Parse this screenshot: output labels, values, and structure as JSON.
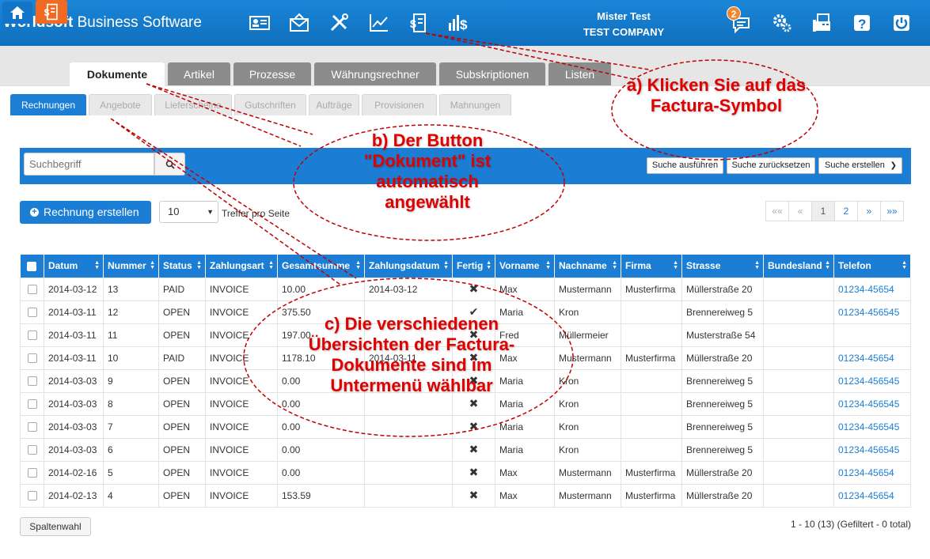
{
  "app": {
    "brand_bold": "Worldsoft",
    "brand_rest": " Business Software",
    "user_name": "Mister Test",
    "company": "TEST COMPANY",
    "notifications": "2"
  },
  "top_icons": [
    "contacts-card-icon",
    "mail-icon",
    "tools-icon",
    "chart-icon",
    "factura-icon",
    "finance-icon",
    "notification-icon",
    "settings-icon",
    "fax-icon",
    "help-icon",
    "power-icon"
  ],
  "main_tabs": [
    {
      "label": "Dokumente"
    },
    {
      "label": "Artikel"
    },
    {
      "label": "Prozesse"
    },
    {
      "label": "Währungsrechner"
    },
    {
      "label": "Subskriptionen"
    },
    {
      "label": "Listen"
    }
  ],
  "sub_tabs": [
    {
      "label": "Rechnungen"
    },
    {
      "label": "Angebote"
    },
    {
      "label": "Lieferscheine"
    },
    {
      "label": "Gutschriften"
    },
    {
      "label": "Aufträge"
    },
    {
      "label": "Provisionen"
    },
    {
      "label": "Mahnungen"
    }
  ],
  "search": {
    "placeholder": "Suchbegriff",
    "execute": "Suche ausführen",
    "reset": "Suche zurücksetzen",
    "create": "Suche erstellen"
  },
  "actions": {
    "create_invoice": "Rechnung erstellen",
    "per_page_value": "10",
    "per_page_label": "Treffer pro Seite"
  },
  "pager": [
    "««",
    "«",
    "1",
    "2",
    "»",
    "»»"
  ],
  "table": {
    "columns": [
      "Datum",
      "Nummer",
      "Status",
      "Zahlungsart",
      "Gesamtsumme",
      "Zahlungsdatum",
      "Fertig",
      "Vorname",
      "Nachname",
      "Firma",
      "Strasse",
      "Bundesland",
      "Telefon"
    ],
    "rows": [
      [
        "2014-03-12",
        "13",
        "PAID",
        "INVOICE",
        "10.00",
        "2014-03-12",
        "✖",
        "Max",
        "Mustermann",
        "Musterfirma",
        "Müllerstraße 20",
        "",
        "01234-45654"
      ],
      [
        "2014-03-11",
        "12",
        "OPEN",
        "INVOICE",
        "375.50",
        "",
        "✔",
        "Maria",
        "Kron",
        "",
        "Brennereiweg 5",
        "",
        "01234-456545"
      ],
      [
        "2014-03-11",
        "11",
        "OPEN",
        "INVOICE",
        "197.00",
        "",
        "✖",
        "Fred",
        "Müllermeier",
        "",
        "Musterstraße 54",
        "",
        ""
      ],
      [
        "2014-03-11",
        "10",
        "PAID",
        "INVOICE",
        "1178.10",
        "2014-03-11",
        "✖",
        "Max",
        "Mustermann",
        "Musterfirma",
        "Müllerstraße 20",
        "",
        "01234-45654"
      ],
      [
        "2014-03-03",
        "9",
        "OPEN",
        "INVOICE",
        "0.00",
        "",
        "✖",
        "Maria",
        "Kron",
        "",
        "Brennereiweg 5",
        "",
        "01234-456545"
      ],
      [
        "2014-03-03",
        "8",
        "OPEN",
        "INVOICE",
        "0.00",
        "",
        "✖",
        "Maria",
        "Kron",
        "",
        "Brennereiweg 5",
        "",
        "01234-456545"
      ],
      [
        "2014-03-03",
        "7",
        "OPEN",
        "INVOICE",
        "0.00",
        "",
        "✖",
        "Maria",
        "Kron",
        "",
        "Brennereiweg 5",
        "",
        "01234-456545"
      ],
      [
        "2014-03-03",
        "6",
        "OPEN",
        "INVOICE",
        "0.00",
        "",
        "✖",
        "Maria",
        "Kron",
        "",
        "Brennereiweg 5",
        "",
        "01234-456545"
      ],
      [
        "2014-02-16",
        "5",
        "OPEN",
        "INVOICE",
        "0.00",
        "",
        "✖",
        "Max",
        "Mustermann",
        "Musterfirma",
        "Müllerstraße 20",
        "",
        "01234-45654"
      ],
      [
        "2014-02-13",
        "4",
        "OPEN",
        "INVOICE",
        "153.59",
        "",
        "✖",
        "Max",
        "Mustermann",
        "Musterfirma",
        "Müllerstraße 20",
        "",
        "01234-45654"
      ]
    ]
  },
  "footer": {
    "columns_button": "Spaltenwahl",
    "summary": "1 - 10 (13) (Gefiltert - 0 total)"
  },
  "annotations": {
    "a": "a) Klicken Sie auf das Factura-Symbol",
    "b": "b) Der Button \"Dokument\" ist automatisch angewählt",
    "c": "c) Die verschiedenen Übersichten der Factura-Dokumente sind im Untermenü wählbar"
  },
  "colors": {
    "primary": "#1b7ed4",
    "accent": "#f26a22",
    "annotation": "#e00000"
  }
}
